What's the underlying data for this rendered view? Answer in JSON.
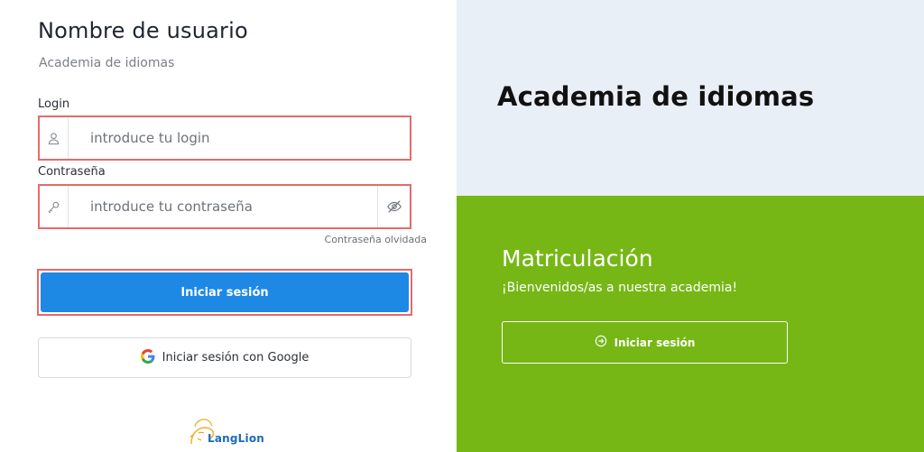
{
  "login_panel": {
    "title": "Nombre de usuario",
    "subtitle": "Academia de idiomas",
    "login_label": "Login",
    "login_placeholder": "introduce tu login",
    "password_label": "Contraseña",
    "password_placeholder": "introduce tu contraseña",
    "forgot_password": "Contraseña olvidada",
    "submit_label": "Iniciar sesión",
    "google_label": "Iniciar sesión con Google",
    "logo_text": "LangLion"
  },
  "hero": {
    "title": "Academia de idiomas"
  },
  "registration": {
    "title": "Matriculación",
    "subtitle": "¡Bienvenidos/as a nuestra academia!",
    "button_label": "Iniciar sesión"
  },
  "colors": {
    "primary": "#1e88e5",
    "error_outline": "#e56b6b",
    "green": "#76b716",
    "light_panel": "#e9eff6"
  },
  "icons": {
    "login": "user-icon",
    "password": "key-icon",
    "toggle_password": "eye-off-icon",
    "google": "google-icon",
    "register": "arrow-circle-right-icon"
  }
}
